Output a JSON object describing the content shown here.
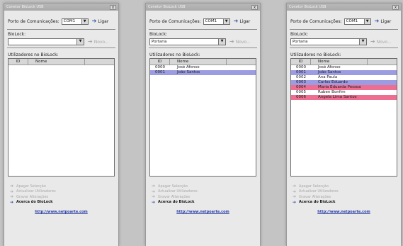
{
  "window_title": "Conetor BioLock USB",
  "close_glyph": "x",
  "port_label": "Porto de Comunicações:",
  "port_value": "COM1",
  "connect_label": "Ligar",
  "biolock_label": "BioLock:",
  "new_label": "Novo...",
  "users_label": "Utilizadores no BioLock:",
  "col_id": "ID",
  "col_name": "Nome",
  "actions": [
    "Apagar Selecção",
    "Actualizar Utilizadores",
    "Gravar Alterações",
    "Acerca do BioLock"
  ],
  "url": "http://www.netpoarte.com",
  "colors": {
    "selected_blue": "#9c9ce2",
    "selected_pink": "#ee6e92",
    "link_blue": "#2b3fa6"
  },
  "panels": [
    {
      "biolock_value": "",
      "rows": []
    },
    {
      "biolock_value": "Portaria",
      "rows": [
        {
          "id": "0000",
          "name": "José Afonso",
          "highlight": "none"
        },
        {
          "id": "0001",
          "name": "João Santos",
          "highlight": "blue"
        }
      ]
    },
    {
      "biolock_value": "Portaria",
      "rows": [
        {
          "id": "0000",
          "name": "José Afonso",
          "highlight": "none"
        },
        {
          "id": "0001",
          "name": "João Santos",
          "highlight": "blue"
        },
        {
          "id": "0002",
          "name": "Ana Paula",
          "highlight": "none"
        },
        {
          "id": "0003",
          "name": "Carlos Eduardo",
          "highlight": "blue"
        },
        {
          "id": "0004",
          "name": "Maria Eduarda Pessoa",
          "highlight": "pink"
        },
        {
          "id": "0005",
          "name": "Ruben Bonfim",
          "highlight": "none"
        },
        {
          "id": "0006",
          "name": "Ângela Lima Santos",
          "highlight": "pink"
        }
      ]
    }
  ]
}
